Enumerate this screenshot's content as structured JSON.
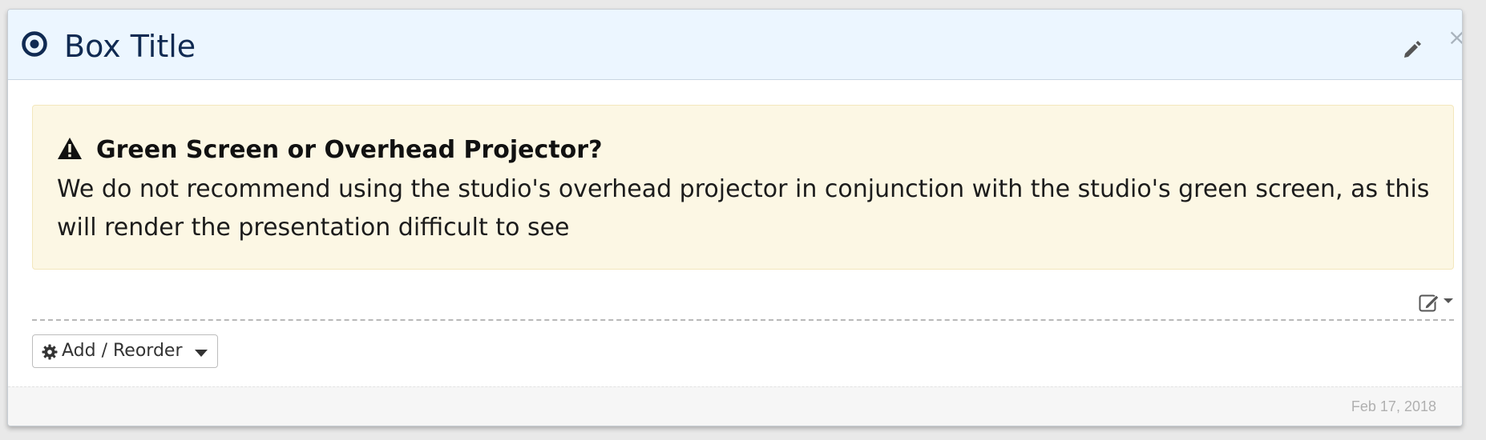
{
  "box": {
    "title": "Box Title",
    "header_icon": "dot-circle-icon",
    "edit_icon": "pencil-icon",
    "close_label": "×"
  },
  "alert": {
    "icon": "warning-icon",
    "title": "Green Screen or Overhead Projector?",
    "body": "We do not recommend using the studio's overhead projector in conjunction with the studio's green screen, as this will render the presentation difficult to see",
    "background_color": "#fcf7e4"
  },
  "block_toolbar": {
    "edit_icon": "edit-square-icon",
    "dropdown_icon": "caret-down-icon"
  },
  "add_reorder": {
    "label": "Add / Reorder",
    "icon": "gear-icon",
    "dropdown_icon": "caret-down-icon"
  },
  "footer": {
    "date": "Feb 17, 2018"
  },
  "colors": {
    "header_bg": "#ecf6ff",
    "title_color": "#102a52",
    "accent": "#102a52"
  }
}
